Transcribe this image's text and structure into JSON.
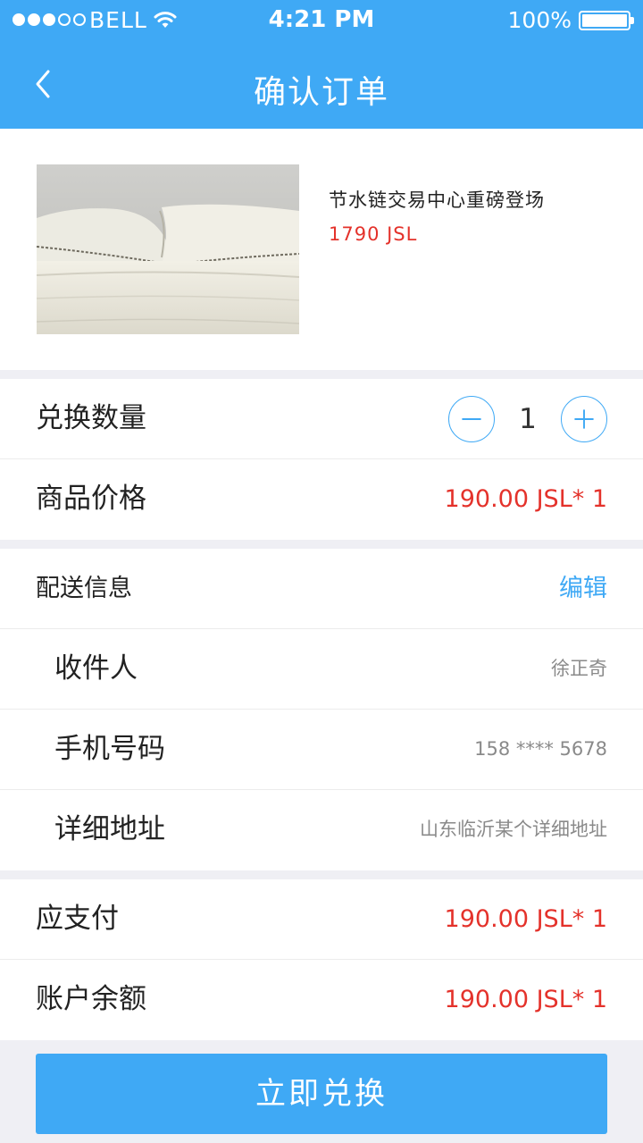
{
  "status_bar": {
    "carrier": "BELL",
    "time": "4:21 PM",
    "battery": "100%",
    "signal_bars_filled": 3,
    "signal_bars_total": 5
  },
  "nav": {
    "title": "确认订单",
    "back_icon": "chevron-left-icon"
  },
  "product": {
    "name": "节水链交易中心重磅登场",
    "price": "1790   JSL"
  },
  "quantity": {
    "label": "兑换数量",
    "value": "1",
    "decrement_icon": "minus-icon",
    "increment_icon": "plus-icon"
  },
  "item_price": {
    "label": "商品价格",
    "value": "190.00 JSL* 1"
  },
  "delivery": {
    "title": "配送信息",
    "edit_label": "编辑",
    "recipient_label": "收件人",
    "recipient_value": "徐正奇",
    "phone_label": "手机号码",
    "phone_value": "158 **** 5678",
    "address_label": "详细地址",
    "address_value": "山东临沂某个详细地址"
  },
  "payment": {
    "due_label": "应支付",
    "due_value": "190.00 JSL* 1",
    "balance_label": "账户余额",
    "balance_value": "190.00 JSL* 1"
  },
  "submit_label": "立即兑换",
  "colors": {
    "accent": "#3fa9f5",
    "price_red": "#e4322b",
    "background": "#efeff4"
  }
}
